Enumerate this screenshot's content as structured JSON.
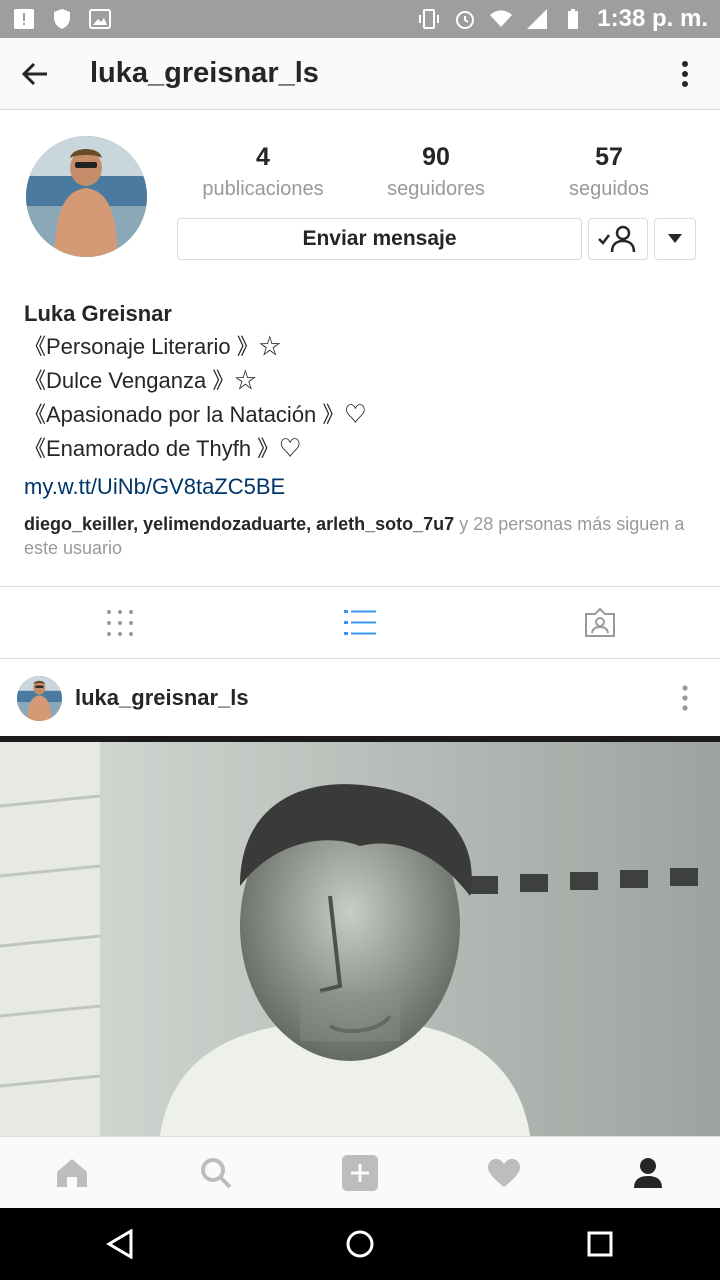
{
  "status_bar": {
    "time": "1:38 p. m.",
    "icons": [
      "alert-icon",
      "shield-icon",
      "image-icon",
      "vibrate-icon",
      "alarm-icon",
      "wifi-icon",
      "signal-icon",
      "battery-icon"
    ]
  },
  "header": {
    "username": "luka_greisnar_ls"
  },
  "profile": {
    "stats": [
      {
        "value": "4",
        "label": "publicaciones"
      },
      {
        "value": "90",
        "label": "seguidores"
      },
      {
        "value": "57",
        "label": "seguidos"
      }
    ],
    "message_button": "Enviar mensaje",
    "name": "Luka Greisnar",
    "bio_lines": [
      "《Personaje Literario 》☆",
      "《Dulce Venganza 》☆",
      "《Apasionado por la Natación 》♡",
      "《Enamorado de Thyfh 》♡"
    ],
    "link": "my.w.tt/UiNb/GV8taZC5BE",
    "followed_by": {
      "users": [
        "diego_keiller",
        "yelimendozaduarte",
        "arleth_soto_7u7"
      ],
      "sep": ", ",
      "rest": " y 28 personas más siguen a este usuario"
    }
  },
  "tabs": {
    "active": "list",
    "items": [
      "grid-icon",
      "list-icon",
      "tagged-icon"
    ]
  },
  "post": {
    "username": "luka_greisnar_ls"
  },
  "colors": {
    "link": "#003569",
    "active_tab": "#3897f0",
    "muted": "#999999",
    "status_bar": "#9e9e9e"
  }
}
